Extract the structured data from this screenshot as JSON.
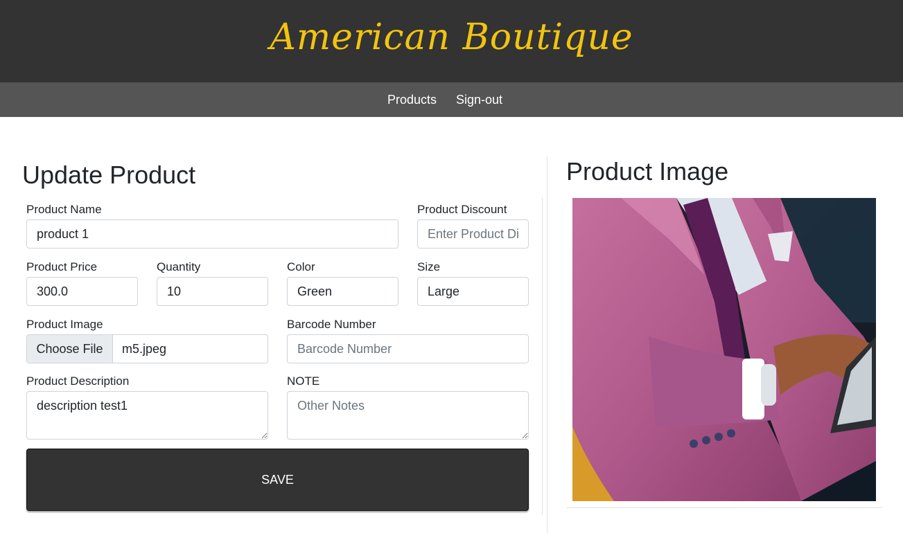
{
  "header": {
    "brand": "American Boutique"
  },
  "nav": {
    "items": [
      "Products",
      "Sign-out"
    ]
  },
  "form": {
    "title": "Update Product",
    "product_name": {
      "label": "Product Name",
      "value": "product 1"
    },
    "product_discount": {
      "label": "Product Discount",
      "placeholder": "Enter Product Discount"
    },
    "product_price": {
      "label": "Product Price",
      "value": "300.0"
    },
    "quantity": {
      "label": "Quantity",
      "value": "10"
    },
    "color": {
      "label": "Color",
      "value": "Green"
    },
    "size": {
      "label": "Size",
      "value": "Large"
    },
    "product_image": {
      "label": "Product Image",
      "button": "Choose File",
      "file_name": "m5.jpeg"
    },
    "barcode": {
      "label": "Barcode Number",
      "placeholder": "Barcode Number"
    },
    "description": {
      "label": "Product Description",
      "value": "description test1"
    },
    "note": {
      "label": "NOTE",
      "placeholder": "Other Notes"
    },
    "save_label": "SAVE"
  },
  "preview": {
    "title": "Product Image"
  },
  "colors": {
    "header_bg": "#333333",
    "nav_bg": "#555555",
    "brand": "#f2c40f",
    "jacket": "#b45c8e"
  }
}
